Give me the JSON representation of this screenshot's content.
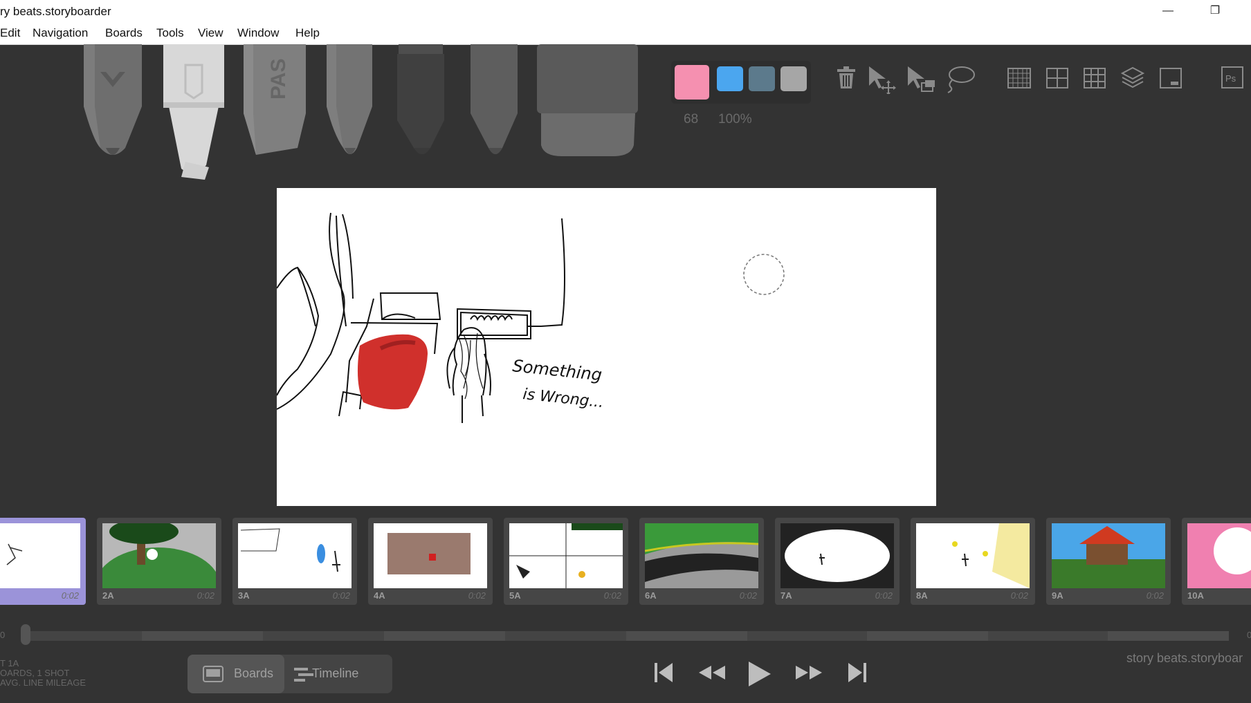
{
  "window": {
    "title": "ry beats.storyboarder",
    "minimize_glyph": "—",
    "restore_glyph": "❐"
  },
  "menu": [
    "Edit",
    "Navigation",
    "Boards",
    "Tools",
    "View",
    "Window",
    "Help"
  ],
  "tools": [
    "light-pencil-icon",
    "brush-icon",
    "tone-icon",
    "pencil-icon",
    "pen-icon",
    "airbrush-icon",
    "eraser-icon"
  ],
  "palette": {
    "colors": [
      "#f590b0",
      "#4ba6ef",
      "#5c7a8c",
      "#a6a6a6"
    ],
    "brush_size": "68",
    "opacity": "100%"
  },
  "toolbar_icons": [
    "trash-icon",
    "move-icon",
    "scale-icon",
    "lasso-icon",
    "grid-icon",
    "center-guide-icon",
    "thirds-guide-icon",
    "onion-skin-icon",
    "caption-icon",
    "photoshop-icon"
  ],
  "drawing_caption": [
    "Something",
    "is Wrong..."
  ],
  "boards": [
    {
      "label": "",
      "duration": "0:02",
      "active": true
    },
    {
      "label": "2A",
      "duration": "0:02"
    },
    {
      "label": "3A",
      "duration": "0:02"
    },
    {
      "label": "4A",
      "duration": "0:02"
    },
    {
      "label": "5A",
      "duration": "0:02"
    },
    {
      "label": "6A",
      "duration": "0:02"
    },
    {
      "label": "7A",
      "duration": "0:02"
    },
    {
      "label": "8A",
      "duration": "0:02"
    },
    {
      "label": "9A",
      "duration": "0:02"
    },
    {
      "label": "10A",
      "duration": ""
    }
  ],
  "scrubber": {
    "left_label": "0",
    "right_label": "0",
    "position": 0
  },
  "status": {
    "line1": "T 1A",
    "line2": "OARDS, 1 SHOT",
    "line3": "AVG. LINE MILEAGE"
  },
  "view_toggle": {
    "boards": "Boards",
    "timeline": "Timeline",
    "active": "boards"
  },
  "transport": [
    "skip-back-icon",
    "rewind-icon",
    "play-icon",
    "fast-forward-icon",
    "skip-forward-icon"
  ],
  "project_label": "story beats.storyboar"
}
